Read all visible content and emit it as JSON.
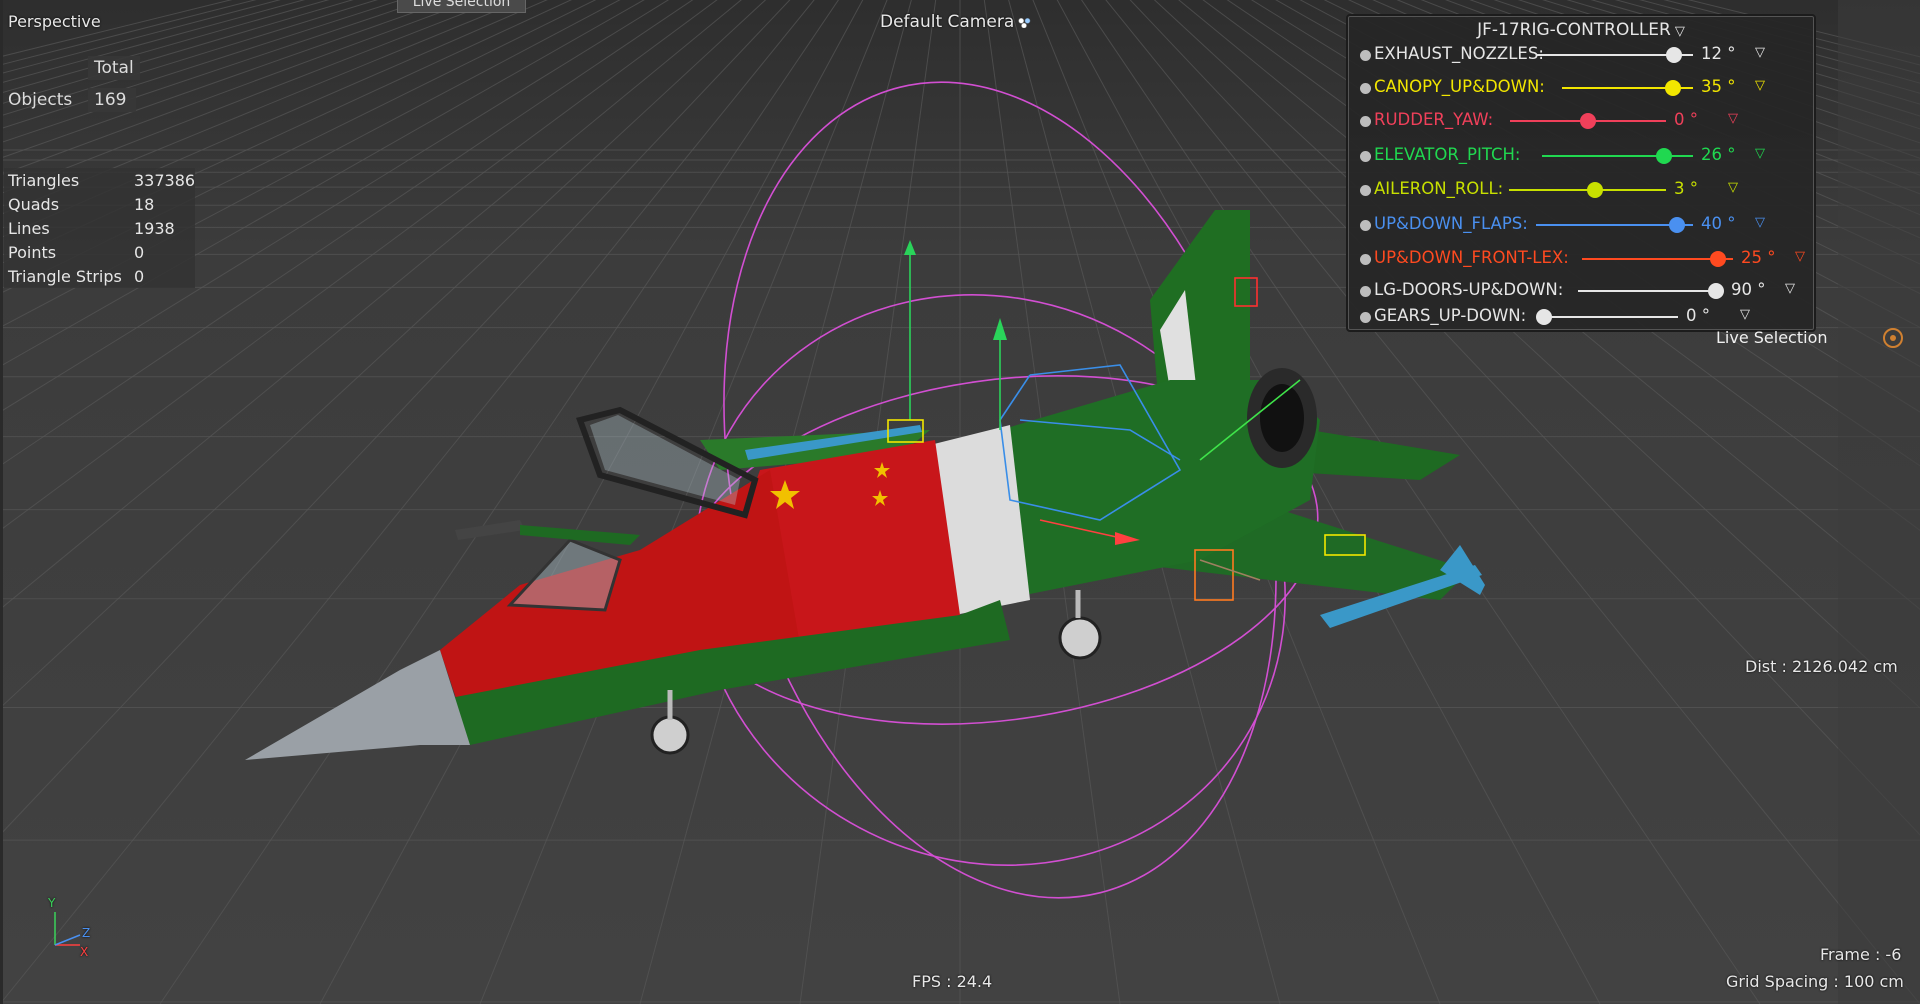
{
  "viewport": {
    "view_name": "Perspective",
    "top_tab": "Live Selection",
    "camera_label": "Default Camera",
    "dist": "Dist : 2126.042 cm",
    "fps": "FPS : 24.4",
    "frame": "Frame : -6",
    "grid_spacing": "Grid Spacing : 100 cm",
    "live_selection": "Live Selection"
  },
  "objects_stats": {
    "header": "Total",
    "label": "Objects",
    "value": "169"
  },
  "mesh_stats": [
    {
      "label": "Triangles",
      "value": "337386"
    },
    {
      "label": "Quads",
      "value": "18"
    },
    {
      "label": "Lines",
      "value": "1938"
    },
    {
      "label": "Points",
      "value": "0"
    },
    {
      "label": "Triangle Strips",
      "value": "0"
    }
  ],
  "axis_gizmo": {
    "y": "Y",
    "z": "Z",
    "x": "X"
  },
  "controller": {
    "title": "JF-17RIG-CONTROLLER",
    "rows": [
      {
        "name": "EXHAUST_NOZZLES:",
        "value": "12 °",
        "color": "#e6e6e6",
        "level": 0.88
      },
      {
        "name": "CANOPY_UP&DOWN:",
        "value": "35 °",
        "color": "#f2e600",
        "level": 0.85
      },
      {
        "name": "RUDDER_YAW:",
        "value": "0 °",
        "color": "#f0405a",
        "level": 0.5
      },
      {
        "name": "ELEVATOR_PITCH:",
        "value": "26 °",
        "color": "#20d850",
        "level": 0.81
      },
      {
        "name": "AILERON_ROLL:",
        "value": "3 °",
        "color": "#c8e000",
        "level": 0.55
      },
      {
        "name": "UP&DOWN_FLAPS:",
        "value": "40 °",
        "color": "#4a90f0",
        "level": 0.9
      },
      {
        "name": "UP&DOWN_FRONT-LEX:",
        "value": "25 °",
        "color": "#ff4a20",
        "level": 0.9
      },
      {
        "name": "LG-DOORS-UP&DOWN:",
        "value": "90 °",
        "color": "#e6e6e6",
        "level": 0.95
      },
      {
        "name": "GEARS_UP-DOWN:",
        "value": "0 °",
        "color": "#e6e6e6",
        "level": 0.0
      }
    ]
  }
}
